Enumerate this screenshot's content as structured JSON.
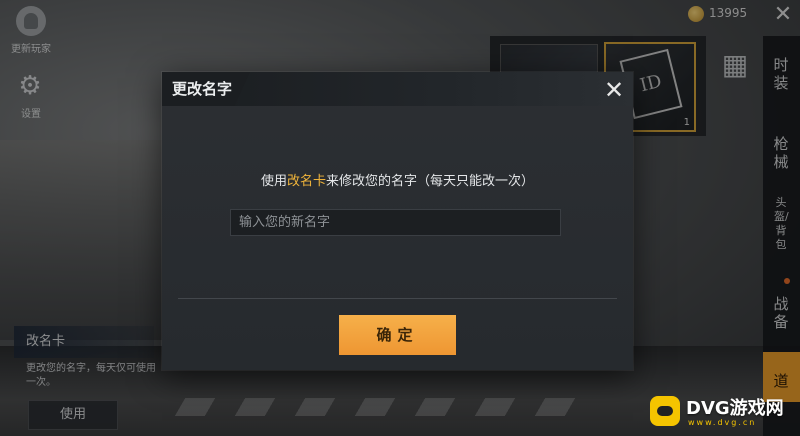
{
  "hud": {
    "avatar_label": "更新玩家",
    "settings_label": "设置",
    "coin_value": "13995"
  },
  "left_card": {
    "title": "改名卡",
    "description": "更改您的名字，每天仅可使用一次。",
    "use_label": "使用"
  },
  "side_tabs": [
    {
      "label": "时装"
    },
    {
      "label": "枪械"
    },
    {
      "label": "头盔/背包"
    },
    {
      "label": "战备"
    },
    {
      "label": "道"
    }
  ],
  "inventory": {
    "card_glyph": "ID",
    "count": "1"
  },
  "dialog": {
    "title": "更改名字",
    "message_before": "使用",
    "message_highlight": "改名卡",
    "message_after": "来修改您的名字（每天只能改一次）",
    "input_placeholder": "输入您的新名字",
    "input_value": "",
    "confirm_label": "确定"
  },
  "watermark": {
    "brand": "DVG游戏网",
    "url": "www.dvg.cn"
  },
  "colors": {
    "accent": "#ee9632",
    "highlight": "#f0b43a",
    "dialog_bg": "#2a2d31"
  }
}
